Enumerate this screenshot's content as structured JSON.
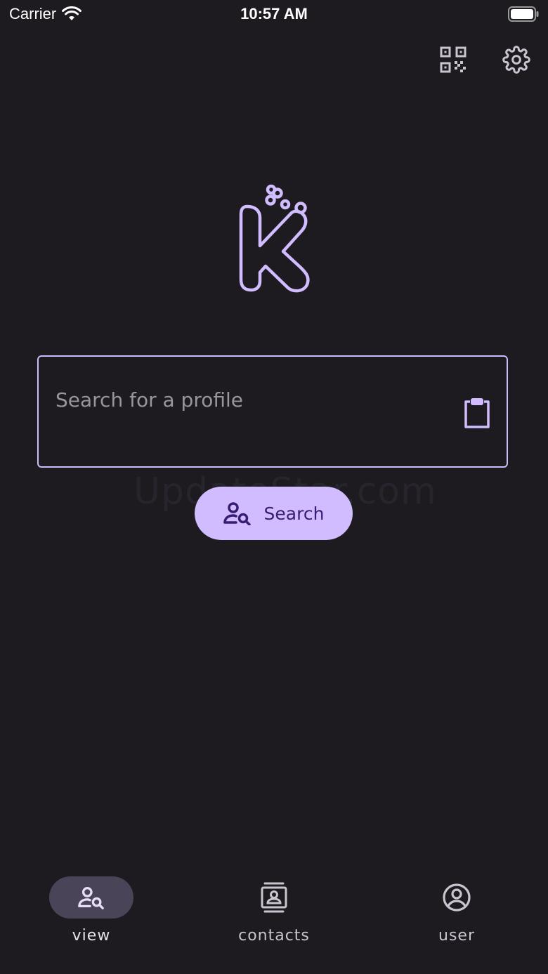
{
  "status_bar": {
    "carrier": "Carrier",
    "time": "10:57 AM"
  },
  "toolbar": {
    "qr_icon": "qr-code-icon",
    "settings_icon": "gear-icon"
  },
  "search": {
    "placeholder": "Search for a profile",
    "value": "",
    "button_label": "Search"
  },
  "watermark": "UpdateStar.com",
  "nav": {
    "items": [
      {
        "label": "view",
        "icon": "person-search-icon",
        "active": true
      },
      {
        "label": "contacts",
        "icon": "contacts-icon",
        "active": false
      },
      {
        "label": "user",
        "icon": "account-circle-icon",
        "active": false
      }
    ]
  },
  "colors": {
    "background": "#1d1b20",
    "accent": "#d0bcff",
    "on_accent": "#381e72",
    "active_pill": "#4a4458"
  }
}
